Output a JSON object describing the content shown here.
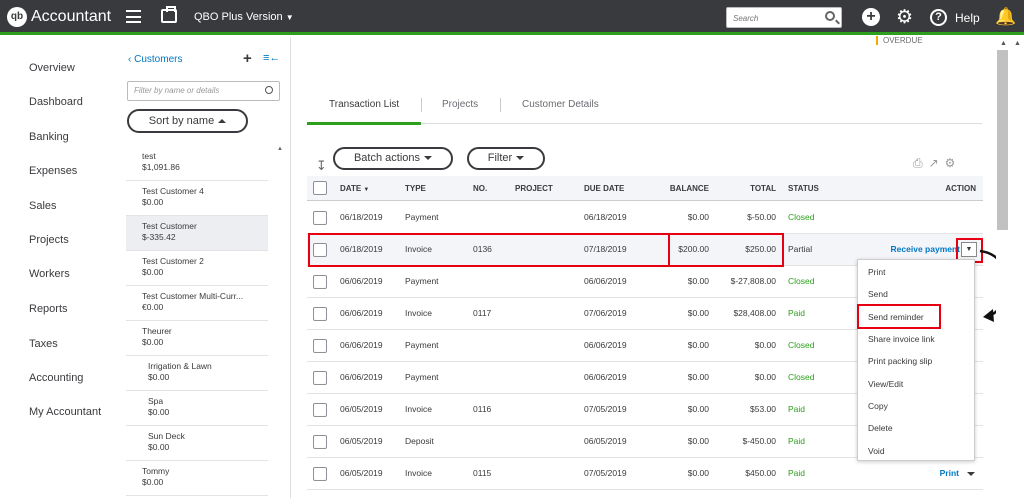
{
  "topbar": {
    "logo": "qb",
    "brand": "Accountant",
    "version": "QBO Plus Version",
    "search_placeholder": "Search",
    "help_label": "Help"
  },
  "nav": {
    "items": [
      "Overview",
      "Dashboard",
      "Banking",
      "Expenses",
      "Sales",
      "Projects",
      "Workers",
      "Reports",
      "Taxes",
      "Accounting",
      "My Accountant"
    ]
  },
  "customers": {
    "back_label": "Customers",
    "filter_placeholder": "Filter by name or details",
    "sort_label": "Sort by name",
    "list": [
      {
        "name": "test",
        "amount": "$1,091.86"
      },
      {
        "name": "Test Customer 4",
        "amount": "$0.00"
      },
      {
        "name": "Test Customer",
        "amount": "$-335.42"
      },
      {
        "name": "Test Customer 2",
        "amount": "$0.00"
      },
      {
        "name": "Test Customer Multi-Curr...",
        "amount": "€0.00"
      },
      {
        "name": "Theurer",
        "amount": "$0.00"
      },
      {
        "name": "Irrigation & Lawn",
        "amount": "$0.00"
      },
      {
        "name": "Spa",
        "amount": "$0.00"
      },
      {
        "name": "Sun Deck",
        "amount": "$0.00"
      },
      {
        "name": "Tommy",
        "amount": "$0.00"
      }
    ]
  },
  "overdue_label": "OVERDUE",
  "tabs": [
    "Transaction List",
    "Projects",
    "Customer Details"
  ],
  "toolbar": {
    "batch_label": "Batch actions",
    "filter_label": "Filter"
  },
  "table": {
    "headers": [
      "DATE",
      "TYPE",
      "NO.",
      "PROJECT",
      "DUE DATE",
      "BALANCE",
      "TOTAL",
      "STATUS",
      "ACTION"
    ],
    "rows": [
      {
        "date": "06/18/2019",
        "type": "Payment",
        "no": "",
        "project": "",
        "due": "06/18/2019",
        "balance": "$0.00",
        "total": "$-50.00",
        "status": "Closed",
        "action": ""
      },
      {
        "date": "06/18/2019",
        "type": "Invoice",
        "no": "0136",
        "project": "",
        "due": "07/18/2019",
        "balance": "$200.00",
        "total": "$250.00",
        "status": "Partial",
        "action": "Receive payment"
      },
      {
        "date": "06/06/2019",
        "type": "Payment",
        "no": "",
        "project": "",
        "due": "06/06/2019",
        "balance": "$0.00",
        "total": "$-27,808.00",
        "status": "Closed",
        "action": ""
      },
      {
        "date": "06/06/2019",
        "type": "Invoice",
        "no": "0117",
        "project": "",
        "due": "07/06/2019",
        "balance": "$0.00",
        "total": "$28,408.00",
        "status": "Paid",
        "action": ""
      },
      {
        "date": "06/06/2019",
        "type": "Payment",
        "no": "",
        "project": "",
        "due": "06/06/2019",
        "balance": "$0.00",
        "total": "$0.00",
        "status": "Closed",
        "action": ""
      },
      {
        "date": "06/06/2019",
        "type": "Payment",
        "no": "",
        "project": "",
        "due": "06/06/2019",
        "balance": "$0.00",
        "total": "$0.00",
        "status": "Closed",
        "action": ""
      },
      {
        "date": "06/05/2019",
        "type": "Invoice",
        "no": "0116",
        "project": "",
        "due": "07/05/2019",
        "balance": "$0.00",
        "total": "$53.00",
        "status": "Paid",
        "action": ""
      },
      {
        "date": "06/05/2019",
        "type": "Deposit",
        "no": "",
        "project": "",
        "due": "06/05/2019",
        "balance": "$0.00",
        "total": "$-450.00",
        "status": "Paid",
        "action": ""
      },
      {
        "date": "06/05/2019",
        "type": "Invoice",
        "no": "0115",
        "project": "",
        "due": "07/05/2019",
        "balance": "$0.00",
        "total": "$450.00",
        "status": "Paid",
        "action": "Print"
      }
    ]
  },
  "menu": {
    "items": [
      "Print",
      "Send",
      "Send reminder",
      "Share invoice link",
      "Print packing slip",
      "View/Edit",
      "Copy",
      "Delete",
      "Void"
    ]
  },
  "colors": {
    "accent": "#2ca01c",
    "link": "#0077c5",
    "highlight": "#e60012",
    "topbar": "#393a3d"
  }
}
